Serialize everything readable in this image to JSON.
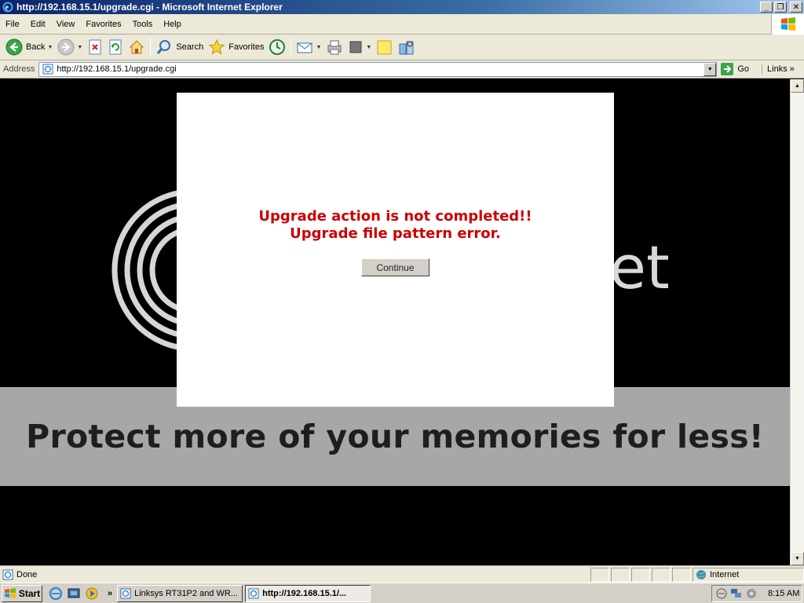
{
  "window": {
    "title": "http://192.168.15.1/upgrade.cgi - Microsoft Internet Explorer",
    "app_icon": "ie-icon"
  },
  "menu": {
    "items": [
      {
        "label": "File"
      },
      {
        "label": "Edit"
      },
      {
        "label": "View"
      },
      {
        "label": "Favorites"
      },
      {
        "label": "Tools"
      },
      {
        "label": "Help"
      }
    ]
  },
  "toolbar": {
    "back_label": "Back",
    "search_label": "Search",
    "favorites_label": "Favorites"
  },
  "address": {
    "label": "Address",
    "url": "http://192.168.15.1/upgrade.cgi",
    "go_label": "Go",
    "links_label": "Links"
  },
  "page": {
    "background_brand_word": "ket",
    "slogan": "Protect more of your memories for less!",
    "error_line1": "Upgrade action is not completed!!",
    "error_line2": "Upgrade file pattern error.",
    "continue_label": "Continue",
    "error_color": "#cc0000"
  },
  "status": {
    "text": "Done",
    "zone": "Internet"
  },
  "taskbar": {
    "start_label": "Start",
    "tasks": [
      {
        "label": "Linksys RT31P2 and WR..."
      },
      {
        "label": "http://192.168.15.1/..."
      }
    ],
    "clock": "8:15 AM"
  }
}
